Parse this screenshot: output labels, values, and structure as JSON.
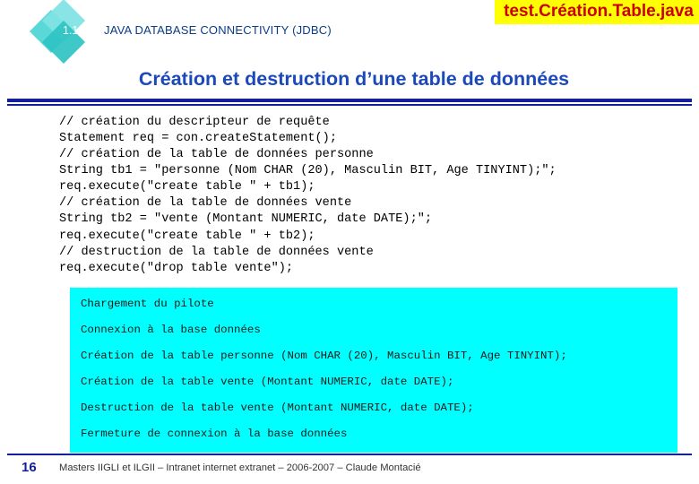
{
  "header": {
    "file_banner": "test.Création.Table.java",
    "section_number": "1.1",
    "section_title": "JAVA DATABASE CONNECTIVITY (JDBC)",
    "slide_title": "Création et destruction d’une table de données"
  },
  "code": {
    "text": "// création du descripteur de requête\nStatement req = con.createStatement();\n// création de la table de données personne\nString tb1 = \"personne (Nom CHAR (20), Masculin BIT, Age TINYINT);\";\nreq.execute(\"create table \" + tb1);\n// création de la table de données vente\nString tb2 = \"vente (Montant NUMERIC, date DATE);\";\nreq.execute(\"create table \" + tb2);\n// destruction de la table de données vente\nreq.execute(\"drop table vente\");"
  },
  "output": {
    "lines": [
      "Chargement du pilote",
      "Connexion à la base données",
      "Création de la table personne (Nom CHAR (20), Masculin BIT, Age TINYINT);",
      "Création de la table vente (Montant NUMERIC, date DATE);",
      "Destruction de la table vente (Montant NUMERIC, date DATE);",
      "Fermeture de connexion à la base données"
    ]
  },
  "footer": {
    "slide_number": "16",
    "text": "Masters IIGLI et ILGII – Intranet internet extranet – 2006-2007 – Claude Montacié"
  },
  "colors": {
    "banner_bg": "#ffff00",
    "banner_text": "#cc0000",
    "title_text": "#1b49b8",
    "rule": "#12209c",
    "output_bg": "#00ffff",
    "diamond": "#5ad7d7"
  }
}
